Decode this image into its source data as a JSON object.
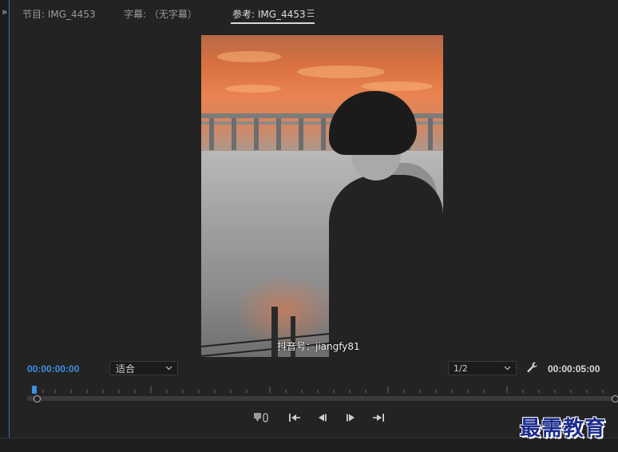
{
  "tabs": [
    {
      "label": "节目: IMG_4453",
      "active": false
    },
    {
      "label": "字幕: （无字幕）",
      "active": false
    },
    {
      "label": "参考: IMG_4453",
      "active": true
    }
  ],
  "viewer": {
    "watermark": "抖音号：jiangfy81"
  },
  "controls": {
    "current_timecode": "00:00:00:00",
    "fit_value": "适合",
    "resolution_value": "1/2",
    "duration_timecode": "00:00:05:00"
  },
  "logo": {
    "text": "最需教育"
  },
  "colors": {
    "accent": "#3d8fe0",
    "background": "#232323",
    "logo": "#1c2c8c"
  }
}
